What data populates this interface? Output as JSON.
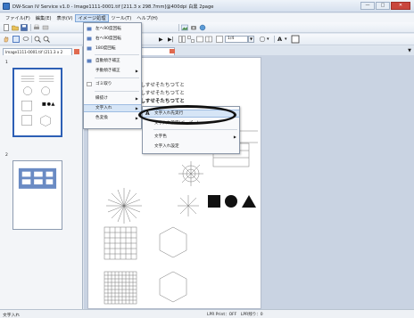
{
  "window": {
    "title": "DW-Scan IV Service v1.0 - Image1111-0001.tif [211.3 x 298.7mm]@400dpi 白黒 2page",
    "minimize": "—",
    "maximize": "□",
    "close": "✕"
  },
  "menubar": [
    "ファイル(F)",
    "編集(E)",
    "表示(V)",
    "イメージ処理",
    "ツール(T)",
    "ヘルプ(H)"
  ],
  "toolbar2": {
    "zoom_value": "1/4",
    "text_btn": "A"
  },
  "left_panel": {
    "tab_label": "Image1111-0001.tif (211.3 x 2",
    "pages": [
      "1",
      "2"
    ]
  },
  "document": {
    "text_lines": [
      "さこさしすせそたちつてと",
      "さこさしすせそたちつてと",
      "さこさしすせそたちつてと"
    ],
    "partial_label": "文字列(F)"
  },
  "image_menu": {
    "items": [
      {
        "label": "左へ90度回転",
        "icon": "rotate-left-icon"
      },
      {
        "label": "右へ90度回転",
        "icon": "rotate-right-icon"
      },
      {
        "label": "180度回転",
        "icon": "rotate-180-icon"
      },
      {
        "label": "自動傾き補正",
        "icon": "deskew-auto-icon"
      },
      {
        "label": "手動傾き補正",
        "icon": "",
        "submenu": true
      },
      {
        "label": "ゴミ取り",
        "icon": "despeckle-icon"
      },
      {
        "label": "縁抜け",
        "icon": "",
        "submenu": true
      },
      {
        "label": "文字入れ",
        "icon": "",
        "submenu": true
      },
      {
        "label": "色変換",
        "icon": "",
        "submenu": true
      }
    ]
  },
  "text_submenu": {
    "items": [
      {
        "label": "文字入れ先実行",
        "icon": "text-a-icon"
      },
      {
        "label": "文字入れ設定(ペーパー)"
      },
      {
        "label": "文字色"
      },
      {
        "label": "文字入れ設定"
      }
    ]
  },
  "statusbar": {
    "left": "文字入れ",
    "right": "LPR Print：OFF　LPR残り：0"
  },
  "colors": {
    "accent": "#2d5fb5",
    "highlight": "#d6e5f6"
  }
}
